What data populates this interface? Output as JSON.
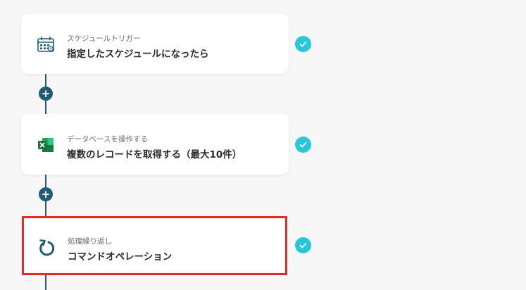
{
  "steps": [
    {
      "subtitle": "スケジュールトリガー",
      "title": "指定したスケジュールになったら",
      "icon": "calendar-clock-icon"
    },
    {
      "subtitle": "データベースを操作する",
      "title": "複数のレコードを取得する（最大10件）",
      "icon": "excel-icon"
    },
    {
      "subtitle": "処理繰り返し",
      "title": "コマンドオペレーション",
      "icon": "loop-icon"
    }
  ],
  "colors": {
    "connector": "#215c73",
    "check": "#27c6d8",
    "selection": "#e12a2a",
    "excel": "#1d6f42"
  }
}
